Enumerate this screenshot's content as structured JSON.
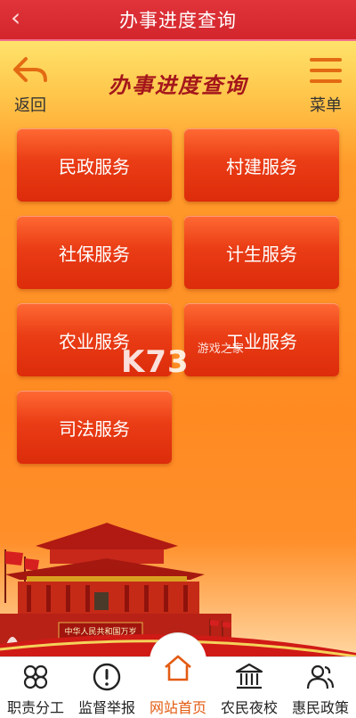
{
  "topbar": {
    "title": "办事进度查询",
    "back_glyph": "‹"
  },
  "header": {
    "back_label": "返回",
    "heading": "办事进度查询",
    "menu_label": "菜单"
  },
  "services": [
    {
      "label": "民政服务"
    },
    {
      "label": "村建服务"
    },
    {
      "label": "社保服务"
    },
    {
      "label": "计生服务"
    },
    {
      "label": "农业服务"
    },
    {
      "label": "工业服务"
    },
    {
      "label": "司法服务"
    }
  ],
  "watermark": {
    "brand": "K73",
    "site": "游戏之家"
  },
  "scene": {
    "plaque_text": "中华人民共和国万岁"
  },
  "tabs": [
    {
      "label": "职责分工",
      "icon": "clover-icon",
      "active": false
    },
    {
      "label": "监督举报",
      "icon": "alert-icon",
      "active": false
    },
    {
      "label": "网站首页",
      "icon": "home-icon",
      "active": true
    },
    {
      "label": "农民夜校",
      "icon": "building-icon",
      "active": false
    },
    {
      "label": "惠民政策",
      "icon": "users-icon",
      "active": false
    }
  ],
  "colors": {
    "topbar_red": "#d3262c",
    "accent_orange": "#e35b12",
    "button_red": "#dc2c0b",
    "heading_red": "#a4161b"
  }
}
